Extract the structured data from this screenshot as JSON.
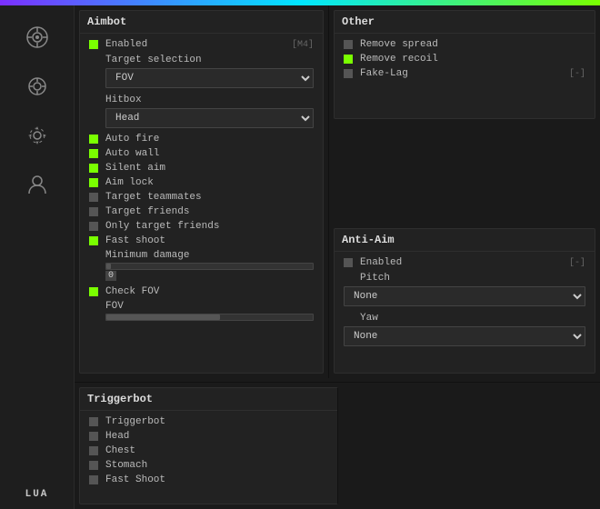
{
  "topbar": {
    "gradient": "rainbow"
  },
  "sidebar": {
    "icons": [
      {
        "name": "aimbot-icon",
        "symbol": "🎯",
        "label": ""
      },
      {
        "name": "visuals-icon",
        "symbol": "☀",
        "label": ""
      },
      {
        "name": "settings-icon",
        "symbol": "⚙",
        "label": ""
      },
      {
        "name": "player-icon",
        "symbol": "👤",
        "label": ""
      }
    ],
    "bottom_label": "LUA"
  },
  "aimbot": {
    "title": "Aimbot",
    "enabled_label": "Enabled",
    "enabled_key": "[M4]",
    "enabled_active": true,
    "target_selection_label": "Target selection",
    "target_selection_value": "FOV",
    "hitbox_label": "Hitbox",
    "hitbox_value": "Head",
    "items": [
      {
        "label": "Auto fire",
        "active": true
      },
      {
        "label": "Auto wall",
        "active": true
      },
      {
        "label": "Silent aim",
        "active": true
      },
      {
        "label": "Aim lock",
        "active": true
      },
      {
        "label": "Target teammates",
        "active": false
      },
      {
        "label": "Target friends",
        "active": false
      },
      {
        "label": "Only target friends",
        "active": false
      },
      {
        "label": "Fast shoot",
        "active": true
      }
    ],
    "min_damage_label": "Minimum damage",
    "min_damage_value": "0",
    "min_damage_fill_pct": 2,
    "check_fov_label": "Check FOV",
    "check_fov_active": true,
    "fov_label": "FOV",
    "fov_fill_pct": 55
  },
  "other": {
    "title": "Other",
    "items": [
      {
        "label": "Remove spread",
        "active": false
      },
      {
        "label": "Remove recoil",
        "active": true
      },
      {
        "label": "Fake-Lag",
        "active": false,
        "key": "[-]"
      }
    ]
  },
  "triggerbot": {
    "title": "Triggerbot",
    "items": [
      {
        "label": "Triggerbot",
        "active": false
      },
      {
        "label": "Head",
        "active": false
      },
      {
        "label": "Chest",
        "active": false
      },
      {
        "label": "Stomach",
        "active": false
      },
      {
        "label": "Fast Shoot",
        "active": false
      }
    ]
  },
  "antiaim": {
    "title": "Anti-Aim",
    "enabled_label": "Enabled",
    "enabled_key": "[-]",
    "enabled_active": false,
    "pitch_label": "Pitch",
    "pitch_value": "None",
    "yaw_label": "Yaw",
    "yaw_value": "None"
  }
}
